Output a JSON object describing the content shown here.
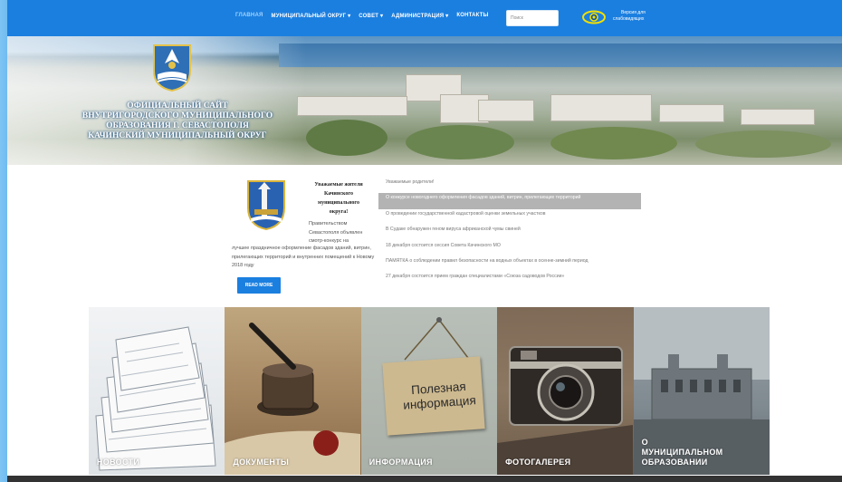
{
  "nav": {
    "items": [
      {
        "label": "Главная",
        "active": true
      },
      {
        "label": "Муниципальный округ ▾",
        "active": false
      },
      {
        "label": "Совет ▾",
        "active": false
      },
      {
        "label": "Администрация ▾",
        "active": false
      },
      {
        "label": "Контакты",
        "active": false
      }
    ],
    "search_placeholder": "Поиск",
    "accessibility_line1": "Версия для",
    "accessibility_line2": "слабовидящих"
  },
  "banner": {
    "title_lines": [
      "Официальный сайт",
      "внутригородского муниципального",
      "образования г. Севастополя",
      "Качинский муниципальный округ"
    ]
  },
  "greeting": {
    "title_lines": [
      "Уважаемые жители",
      "Качинского",
      "муниципального",
      "округа!"
    ],
    "body_short": "Правительством Севастополя объявлен смотр-конкурс на",
    "body_rest": "лучшее праздничное оформление фасадов зданий, витрин, прилегающих территорий и внутренних помещений к Новому 2018 году",
    "read_more": "READ MORE"
  },
  "news": [
    {
      "text": "Уважаемые родители!",
      "highlight": false
    },
    {
      "text": "О конкурсе новогоднего оформления фасадов зданий, витрин, прилегающих территорий",
      "highlight": true
    },
    {
      "text": "О проведении государственной кадастровой оценки земельных участков",
      "highlight": false
    },
    {
      "text": "В Судаке обнаружен геном вируса африканской чумы свиней",
      "highlight": false
    },
    {
      "text": "18 декабря состоится сессия Совета Качинского МО",
      "highlight": false
    },
    {
      "text": "ПАМЯТКА о соблюдении правил безопасности на водных объектах в осенне-зимний период",
      "highlight": false
    },
    {
      "text": "27 декабря состоится прием граждан специалистами «Союза садоводов России»",
      "highlight": false
    }
  ],
  "tiles": [
    {
      "label": "Новости"
    },
    {
      "label": "Документы"
    },
    {
      "label": "Информация",
      "sign_line1": "Полезная",
      "sign_line2": "информация"
    },
    {
      "label": "Фотогалерея"
    },
    {
      "label_line1": "О",
      "label_line2": "муниципальном",
      "label_line3": "образовании"
    }
  ],
  "colors": {
    "nav_bg": "#1b7fe0",
    "highlight_row": "#b3b3b3",
    "button": "#1b7fe0"
  }
}
